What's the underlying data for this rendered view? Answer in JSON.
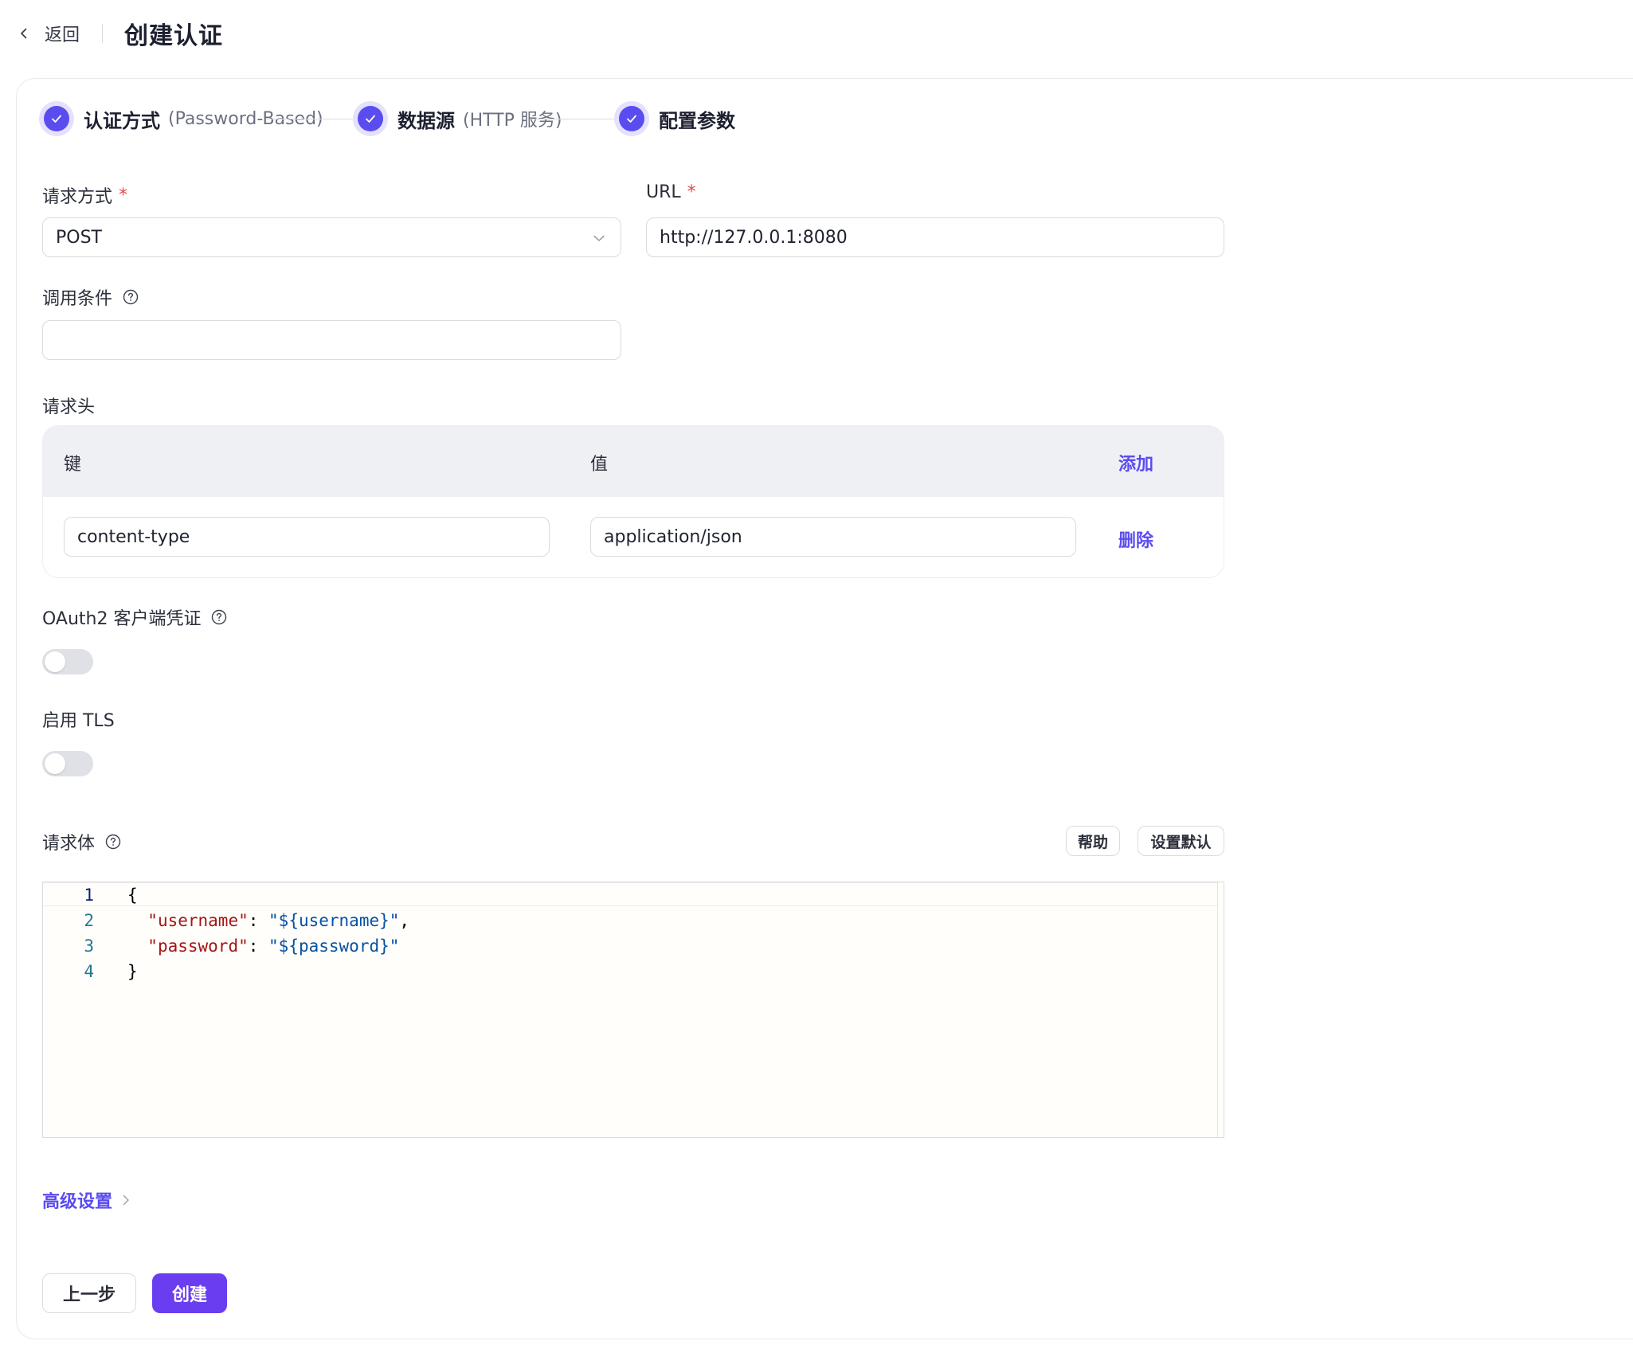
{
  "header": {
    "back_label": "返回",
    "title": "创建认证"
  },
  "steps": [
    {
      "title": "认证方式",
      "sub": "(Password-Based)"
    },
    {
      "title": "数据源",
      "sub": "(HTTP 服务)"
    },
    {
      "title": "配置参数",
      "sub": ""
    }
  ],
  "form": {
    "method": {
      "label": "请求方式",
      "required": "*",
      "value": "POST"
    },
    "url": {
      "label": "URL",
      "required": "*",
      "value": "http://127.0.0.1:8080"
    },
    "condition": {
      "label": "调用条件",
      "value": ""
    },
    "headers": {
      "label": "请求头",
      "col_key": "键",
      "col_value": "值",
      "add_label": "添加",
      "rows": [
        {
          "key": "content-type",
          "value": "application/json",
          "delete_label": "删除"
        }
      ]
    },
    "oauth2": {
      "label": "OAuth2 客户端凭证",
      "enabled": false
    },
    "tls": {
      "label": "启用 TLS",
      "enabled": false
    },
    "body": {
      "label": "请求体",
      "help_label": "帮助",
      "default_label": "设置默认",
      "line_numbers": [
        "1",
        "2",
        "3",
        "4"
      ],
      "lines": [
        {
          "text": "{"
        },
        {
          "indent": "  ",
          "key": "\"username\"",
          "sep": ": ",
          "value": "\"${username}\"",
          "tail": ","
        },
        {
          "indent": "  ",
          "key": "\"password\"",
          "sep": ": ",
          "value": "\"${password}\"",
          "tail": ""
        },
        {
          "text": "}"
        }
      ]
    }
  },
  "advanced_label": "高级设置",
  "actions": {
    "prev_label": "上一步",
    "create_label": "创建"
  },
  "colors": {
    "accent": "#5b4cf0",
    "primary_button": "#6a3df0",
    "required": "#e5484d"
  }
}
